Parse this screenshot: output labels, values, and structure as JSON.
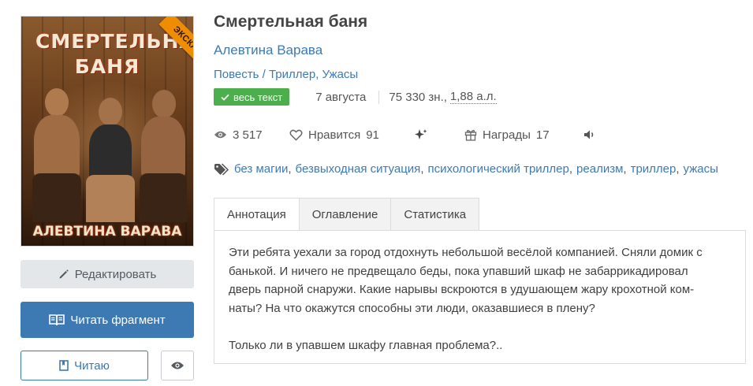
{
  "cover": {
    "title": "СМЕРТЕЛЬНАЯ БАНЯ",
    "author": "АЛЕВТИНА ВАРАВА",
    "ribbon": "ЭКСКЛЮЗИВ"
  },
  "buttons": {
    "edit": "Редактировать",
    "read_fragment": "Читать фрагмент",
    "reading": "Читаю"
  },
  "book": {
    "title": "Смертельная баня",
    "author": "Алевтина Варава",
    "genres": "Повесть / Триллер, Ужасы",
    "badge": "весь текст",
    "date": "7 августа",
    "size": "75 330 зн., ",
    "size_al": "1,88 а.л."
  },
  "stats": {
    "views": "3 517",
    "likes_label": "Нравится",
    "likes": "91",
    "awards_label": "Награды",
    "awards": "17"
  },
  "tags": [
    "без магии",
    "безвыходная ситуация",
    "психологический триллер",
    "реализм",
    "триллер",
    "ужасы"
  ],
  "tabs": [
    "Аннотация",
    "Оглавление",
    "Статистика"
  ],
  "annotation": {
    "line1": "Эти ребята уехали за город отдохнуть небольшой весёлой компанией. Сняли домик с",
    "line2": "банькой. И ничего не предвещало беды, пока упавший шкаф не забаррикадировал",
    "line3": "дверь парной снаружи. Какие нарывы вскроются в удушающем жару крохотной ком-",
    "line4": "наты? На что окажутся способны эти люди, оказавшиеся в плену?",
    "line5": "Только ли в упавшем шкафу главная проблема?.."
  },
  "colors": {
    "link": "#3d7ab4",
    "badge": "#4cae4c",
    "ribbon": "#f08c00",
    "primary_button": "#3d7ab4"
  },
  "icons": [
    "eye-icon",
    "heart-icon",
    "sparkle-icon",
    "gift-icon",
    "speaker-icon",
    "tag-icon",
    "pencil-icon",
    "book-open-icon",
    "bookmark-icon",
    "check-icon"
  ]
}
